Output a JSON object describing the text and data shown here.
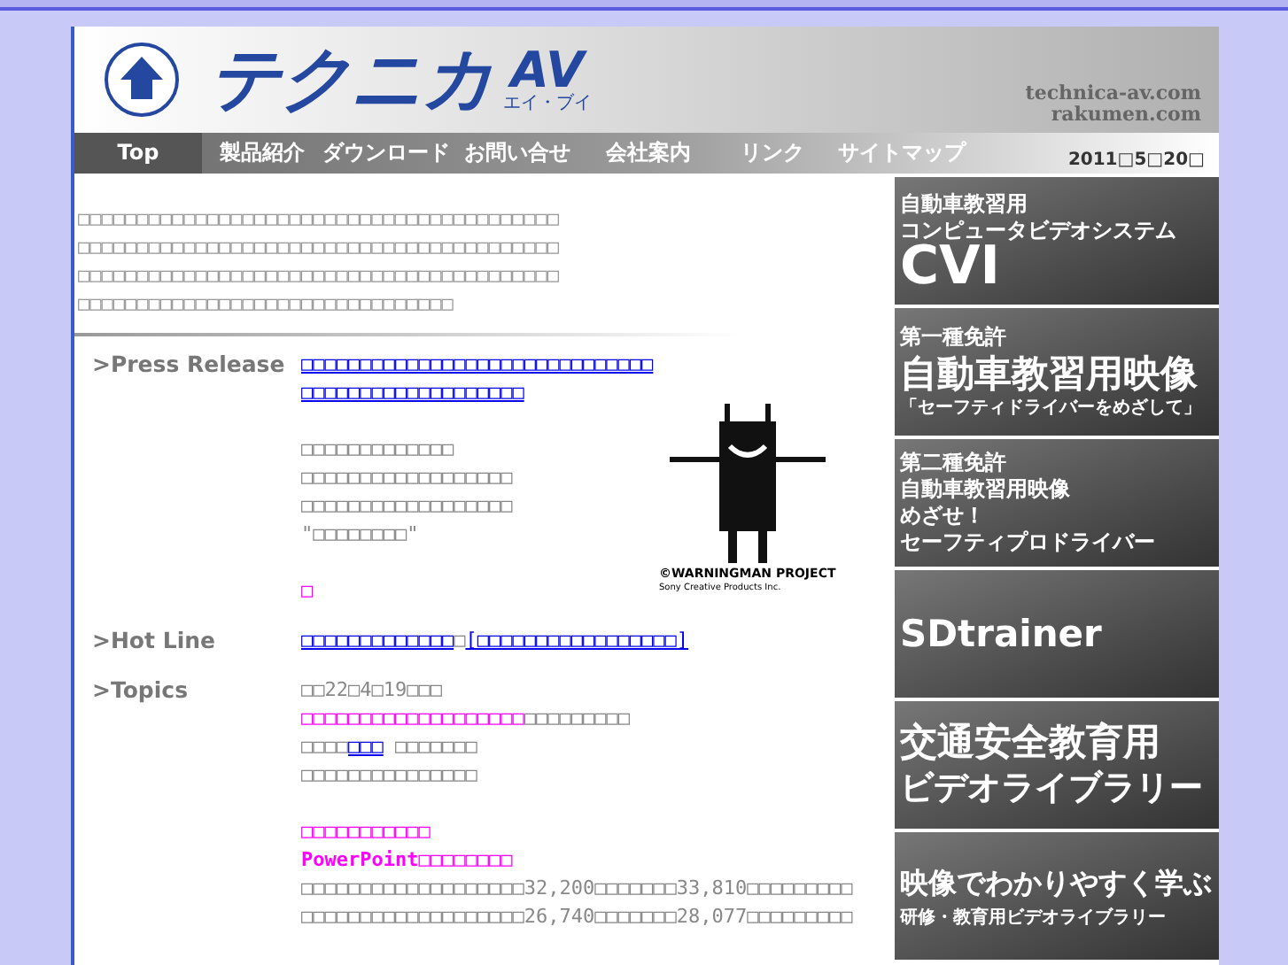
{
  "header": {
    "logo_text": "テクニカ",
    "logo_av": "AV",
    "logo_reading": "エイ・ブイ",
    "domains": [
      "technica-av.com",
      "rakumen.com"
    ]
  },
  "nav": [
    {
      "label": "Top",
      "selected": true
    },
    {
      "label": "製品紹介",
      "selected": false
    },
    {
      "label": "ダウンロード",
      "selected": false
    },
    {
      "label": "お問い合せ",
      "selected": false
    },
    {
      "label": "会社案内",
      "selected": false
    },
    {
      "label": "リンク",
      "selected": false
    },
    {
      "label": "サイトマップ",
      "selected": false
    }
  ],
  "date": "2011□5□20□",
  "intro": [
    "□□□□□□□□□□□□□□□□□□□□□□□□□□□□□□□□□□□□□□□□□",
    "□□□□□□□□□□□□□□□□□□□□□□□□□□□□□□□□□□□□□□□□□",
    "□□□□□□□□□□□□□□□□□□□□□□□□□□□□□□□□□□□□□□□□□",
    "□□□□□□□□□□□□□□□□□□□□□□□□□□□□□□□□"
  ],
  "sections": [
    {
      "label": ">Press Release",
      "paragraphs": [
        [
          [
            {
              "kind": "link",
              "text": "□□□□□□□□□□□□□□□□□□□□□□□□□□□□□□"
            }
          ],
          [
            {
              "kind": "link",
              "text": "□□□□□□□□□□□□□□□□□□□"
            }
          ]
        ],
        [
          [
            {
              "kind": "text",
              "text": "□□□□□□□□□□□□□"
            }
          ],
          [
            {
              "kind": "text",
              "text": "□□□□□□□□□□□□□□□□□□"
            }
          ],
          [
            {
              "kind": "text",
              "text": "□□□□□□□□□□□□□□□□□□"
            }
          ],
          [
            {
              "kind": "text",
              "text": "\"□□□□□□□□\""
            }
          ]
        ],
        [
          [
            {
              "kind": "highlight",
              "text": "□"
            }
          ]
        ]
      ],
      "figure": {
        "credit": "©WARNINGMAN PROJECT",
        "company": "Sony Creative Products Inc."
      }
    },
    {
      "label": ">Hot Line",
      "paragraphs": [
        [
          [
            {
              "kind": "link",
              "text": "□□□□□□□□□□□□□"
            },
            {
              "kind": "text",
              "text": "□"
            },
            {
              "kind": "link",
              "text": "[□□□□□□□□□□□□□□□□□]"
            }
          ]
        ]
      ]
    },
    {
      "label": ">Topics",
      "paragraphs": [
        [
          [
            {
              "kind": "text",
              "text": "□□22□4□19□□□"
            }
          ],
          [
            {
              "kind": "highlight",
              "text": "□□□□□□□□□□□□□□□□□□□"
            },
            {
              "kind": "text",
              "text": "□□□□□□□□□"
            }
          ],
          [
            {
              "kind": "text",
              "text": "□□□□"
            },
            {
              "kind": "link",
              "text": "□□□"
            },
            {
              "kind": "text",
              "text": " □□□□□□□"
            }
          ],
          [
            {
              "kind": "text",
              "text": "□□□□□□□□□□□□□□□"
            }
          ]
        ],
        [
          [
            {
              "kind": "highlight",
              "text": "□□□□□□□□□□□"
            }
          ],
          [
            {
              "kind": "highlight_bold",
              "text": "PowerPoint□□□□□□□□"
            }
          ],
          [
            {
              "kind": "text",
              "text": "□□□□□□□□□□□□□□□□□□□32,200□□□□□□□33,810□□□□□□□□□"
            }
          ],
          [
            {
              "kind": "text",
              "text": "□□□□□□□□□□□□□□□□□□□26,740□□□□□□□28,077□□□□□□□□□"
            }
          ]
        ]
      ]
    }
  ],
  "banners": [
    {
      "lines": [
        "自動車教習用",
        "コンピュータビデオシステム"
      ],
      "big": "CVI"
    },
    {
      "lines": [
        "第一種免許"
      ],
      "big": "自動車教習用映像",
      "sub": "「セーフティドライバーをめざして」"
    },
    {
      "lines": [
        "第二種免許",
        "自動車教習用映像",
        "めざせ！",
        "セーフティプロドライバー"
      ]
    },
    {
      "big": "SDtrainer"
    },
    {
      "big": "交通安全教育用",
      "big2": "ビデオライブラリー"
    },
    {
      "big": "映像でわかりやすく学ぶ",
      "sub": "研修・教育用ビデオライブラリー"
    }
  ]
}
